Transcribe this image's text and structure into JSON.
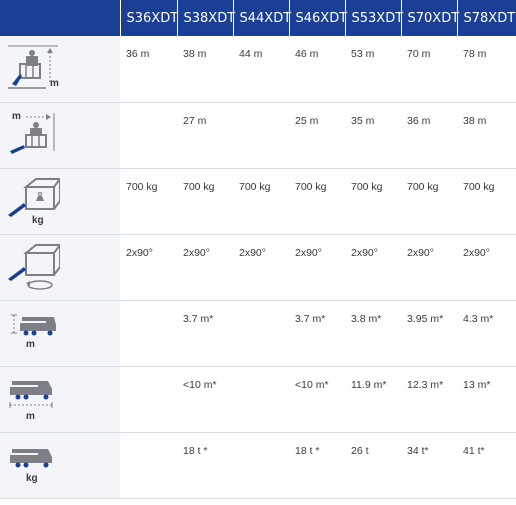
{
  "columns": [
    "",
    "S36XDT",
    "S38XDT",
    "S44XDT",
    "S46XDT",
    "S53XDT",
    "S70XDT",
    "S78XDT"
  ],
  "rows": [
    {
      "icon": "max-working-height-icon",
      "icon_unit": "m",
      "cells": [
        "36 m",
        "38 m",
        "44 m",
        "46 m",
        "53 m",
        "70 m",
        "78 m"
      ]
    },
    {
      "icon": "max-horizontal-outreach-icon",
      "icon_unit": "m",
      "cells": [
        "",
        "27 m",
        "",
        "25 m",
        "35 m",
        "36 m",
        "38 m"
      ]
    },
    {
      "icon": "platform-capacity-icon",
      "icon_unit": "kg",
      "cells": [
        "700 kg",
        "700 kg",
        "700 kg",
        "700 kg",
        "700 kg",
        "700 kg",
        "700 kg"
      ]
    },
    {
      "icon": "platform-rotation-icon",
      "icon_unit": "",
      "cells": [
        "2x90°",
        "2x90°",
        "2x90°",
        "2x90°",
        "2x90°",
        "2x90°",
        "2x90°"
      ]
    },
    {
      "icon": "stowed-height-icon",
      "icon_unit": "m",
      "cells": [
        "",
        "3.7 m*",
        "",
        "3.7 m*",
        "3.8 m*",
        "3.95 m*",
        "4.3 m*"
      ]
    },
    {
      "icon": "stowed-length-icon",
      "icon_unit": "m",
      "cells": [
        "",
        "<10 m*",
        "",
        "<10 m*",
        "11.9 m*",
        "12.3 m*",
        "13 m*"
      ]
    },
    {
      "icon": "vehicle-weight-icon",
      "icon_unit": "kg",
      "cells": [
        "",
        "18 t *",
        "",
        "18 t *",
        "26 t",
        "34 t*",
        "41 t*"
      ]
    }
  ],
  "colors": {
    "header_bg": "#1b3f95",
    "header_text": "#ffffff",
    "icon_gray": "#7d7f86",
    "icon_blue": "#1b3f95"
  }
}
